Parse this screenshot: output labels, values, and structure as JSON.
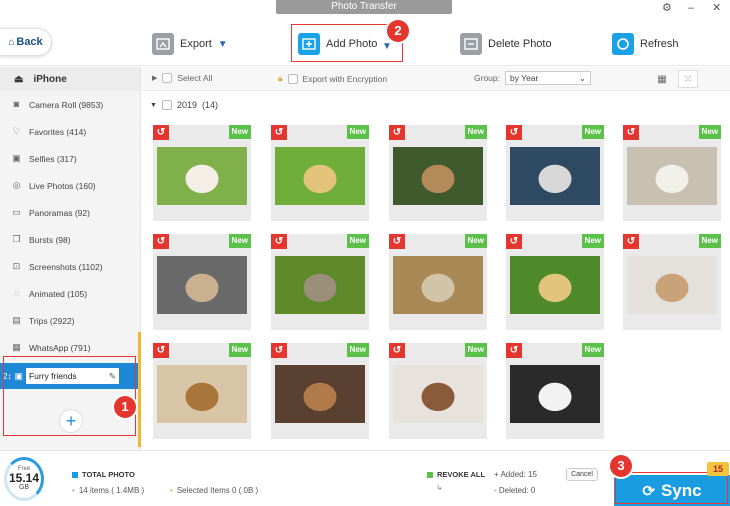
{
  "window": {
    "title": "Photo Transfer",
    "settings_glyph": "⚙",
    "minimize_glyph": "–",
    "close_glyph": "✕"
  },
  "toolbar": {
    "back_label": "Back",
    "export_label": "Export",
    "add_photo_label": "Add Photo",
    "delete_photo_label": "Delete Photo",
    "refresh_label": "Refresh"
  },
  "annotations": {
    "step1": "1",
    "step2": "2",
    "step3": "3"
  },
  "sidebar": {
    "device": "iPhone",
    "items": [
      {
        "label": "Camera Roll (9853)",
        "icon": "camera-icon"
      },
      {
        "label": "Favorites (414)",
        "icon": "heart-icon"
      },
      {
        "label": "Selfies (317)",
        "icon": "selfie-icon"
      },
      {
        "label": "Live Photos (160)",
        "icon": "live-photo-icon"
      },
      {
        "label": "Panoramas (92)",
        "icon": "panorama-icon"
      },
      {
        "label": "Bursts (98)",
        "icon": "bursts-icon"
      },
      {
        "label": "Screenshots (1102)",
        "icon": "screenshot-icon"
      },
      {
        "label": "Animated (105)",
        "icon": "animated-icon"
      },
      {
        "label": "Trips (2922)",
        "icon": "trips-icon"
      },
      {
        "label": "WhatsApp (791)",
        "icon": "whatsapp-icon"
      }
    ],
    "new_album_value": "Furry friends"
  },
  "filter": {
    "select_all": "Select All",
    "export_encryption": "Export with Encryption",
    "group_label": "Group:",
    "group_value": "by Year"
  },
  "gallery": {
    "year_label": "2019",
    "count_label": "(14)",
    "revoke_glyph": "↺",
    "new_label": "New"
  },
  "bottom": {
    "storage_free_label": "Free",
    "storage_value": "15.14",
    "storage_unit": "GB",
    "total_photo_label": "TOTAL PHOTO",
    "items_label": "14 items ( 1.4MB )",
    "selected_label": "Selected Items 0 ( 0B )",
    "revoke_all_label": "REVOKE ALL",
    "added_label": "+ Added: 15",
    "deleted_label": "- Deleted: 0",
    "cancel_label": "Cancel",
    "sync_label": "Sync",
    "sync_badge": "15"
  },
  "colors": {
    "accent": "#1a9ce2",
    "new_badge": "#5cc14b",
    "revoke": "#e4352f",
    "annotation": "#e4352f"
  }
}
